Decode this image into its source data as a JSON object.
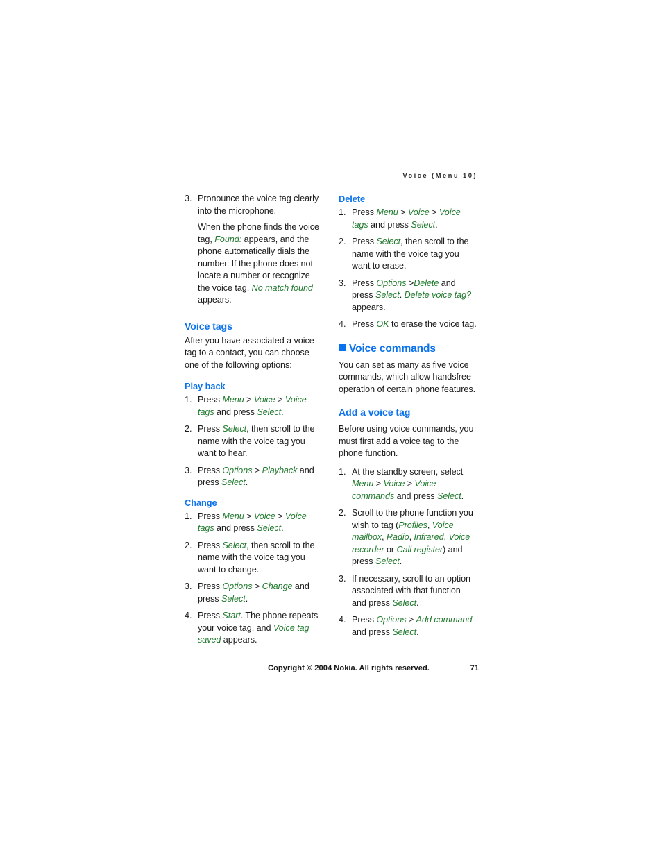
{
  "page": {
    "running_head": "Voice (Menu 10)",
    "footer_copyright": "Copyright © 2004 Nokia. All rights reserved.",
    "footer_page_number": "71",
    "colors": {
      "heading_blue": "#0a72ec",
      "ui_term_green": "#217a2e",
      "body_text": "#1a1a1a",
      "background": "#ffffff"
    }
  },
  "left_column": {
    "step3": {
      "number": "3.",
      "text": "Pronounce the voice tag clearly into the microphone.",
      "paragraph_lead": "When the phone finds the voice tag, ",
      "paragraph_msg1": "Found:",
      "paragraph_mid": " appears, and the phone automatically dials the number. If the phone does not locate a number or recognize the voice tag, ",
      "paragraph_msg2": "No match found",
      "paragraph_tail": " appears."
    },
    "voice_tags": {
      "heading": "Voice tags",
      "intro": "After you have associated a voice tag to a contact, you can choose one of the following options:"
    },
    "play_back": {
      "heading": "Play back",
      "steps": [
        {
          "number": "1.",
          "lead": "Press ",
          "ui1": "Menu",
          "sep1": " > ",
          "ui2": "Voice",
          "sep2": " > ",
          "ui3": "Voice tags",
          "mid": " and press ",
          "ui4": "Select",
          "tail": "."
        },
        {
          "number": "2.",
          "lead": "Press ",
          "ui1": "Select",
          "tail": ", then scroll to the name with the voice tag you want to hear."
        },
        {
          "number": "3.",
          "lead": "Press ",
          "ui1": "Options",
          "sep1": " > ",
          "ui2": "Playback",
          "mid": " and press ",
          "ui3": "Select",
          "tail": "."
        }
      ]
    },
    "change": {
      "heading": "Change",
      "steps": [
        {
          "number": "1.",
          "lead": "Press ",
          "ui1": "Menu",
          "sep1": " > ",
          "ui2": "Voice",
          "sep2": " > ",
          "ui3": "Voice tags",
          "mid": " and press ",
          "ui4": "Select",
          "tail": "."
        },
        {
          "number": "2.",
          "lead": "Press ",
          "ui1": "Select",
          "tail": ", then scroll to the name with the voice tag you want to change."
        },
        {
          "number": "3.",
          "lead": "Press ",
          "ui1": "Options",
          "sep1": " > ",
          "ui2": "Change",
          "mid": " and press ",
          "ui3": "Select",
          "tail": "."
        },
        {
          "number": "4.",
          "lead": "Press ",
          "ui1": "Start",
          "mid": ". The phone repeats your voice tag, and ",
          "msg1": "Voice tag saved",
          "tail": " appears."
        }
      ]
    }
  },
  "right_column": {
    "delete": {
      "heading": "Delete",
      "steps": [
        {
          "number": "1.",
          "lead": "Press ",
          "ui1": "Menu",
          "sep1": " > ",
          "ui2": "Voice",
          "sep2": " > ",
          "ui3": "Voice tags",
          "mid": " and press ",
          "ui4": "Select",
          "tail": "."
        },
        {
          "number": "2.",
          "lead": "Press ",
          "ui1": "Select",
          "tail": ", then scroll to the name with the voice tag you want to erase."
        },
        {
          "number": "3.",
          "lead": "Press ",
          "ui1": "Options",
          "sep1": " >",
          "ui2": "Delete",
          "mid": " and press ",
          "ui3": "Select",
          "mid2": ". ",
          "msg1": "Delete voice tag?",
          "tail": " appears."
        },
        {
          "number": "4.",
          "lead": "Press ",
          "ui1": "OK",
          "tail": " to erase the voice tag."
        }
      ]
    },
    "voice_commands": {
      "heading": "Voice commands",
      "intro": "You can set as many as five voice commands, which allow handsfree operation of certain phone features."
    },
    "add_a_voice_tag": {
      "heading": "Add a voice tag",
      "intro": "Before using voice commands, you must first add a voice tag to the phone function.",
      "steps": [
        {
          "number": "1.",
          "lead": "At the standby screen, select ",
          "ui1": "Menu",
          "sep1": " > ",
          "ui2": "Voice",
          "sep2": " > ",
          "ui3": "Voice commands",
          "mid": " and press ",
          "ui4": "Select",
          "tail": "."
        },
        {
          "number": "2.",
          "lead": "Scroll to the phone function you wish to tag (",
          "ui1": "Profiles",
          "sep1": ", ",
          "ui2": "Voice mailbox",
          "sep2": ", ",
          "ui3": "Radio",
          "sep3": ", ",
          "ui4": "Infrared",
          "sep4": ", ",
          "ui5": "Voice recorder",
          "sep5": " or ",
          "ui6": "Call register",
          "mid": ") and press ",
          "ui7": "Select",
          "tail": "."
        },
        {
          "number": "3.",
          "lead": "If necessary, scroll to an option associated with that function and press ",
          "ui1": "Select",
          "tail": "."
        },
        {
          "number": "4.",
          "lead": "Press ",
          "ui1": "Options",
          "sep1": " > ",
          "ui2": "Add command",
          "mid": " and press ",
          "ui3": "Select",
          "tail": "."
        }
      ]
    }
  }
}
